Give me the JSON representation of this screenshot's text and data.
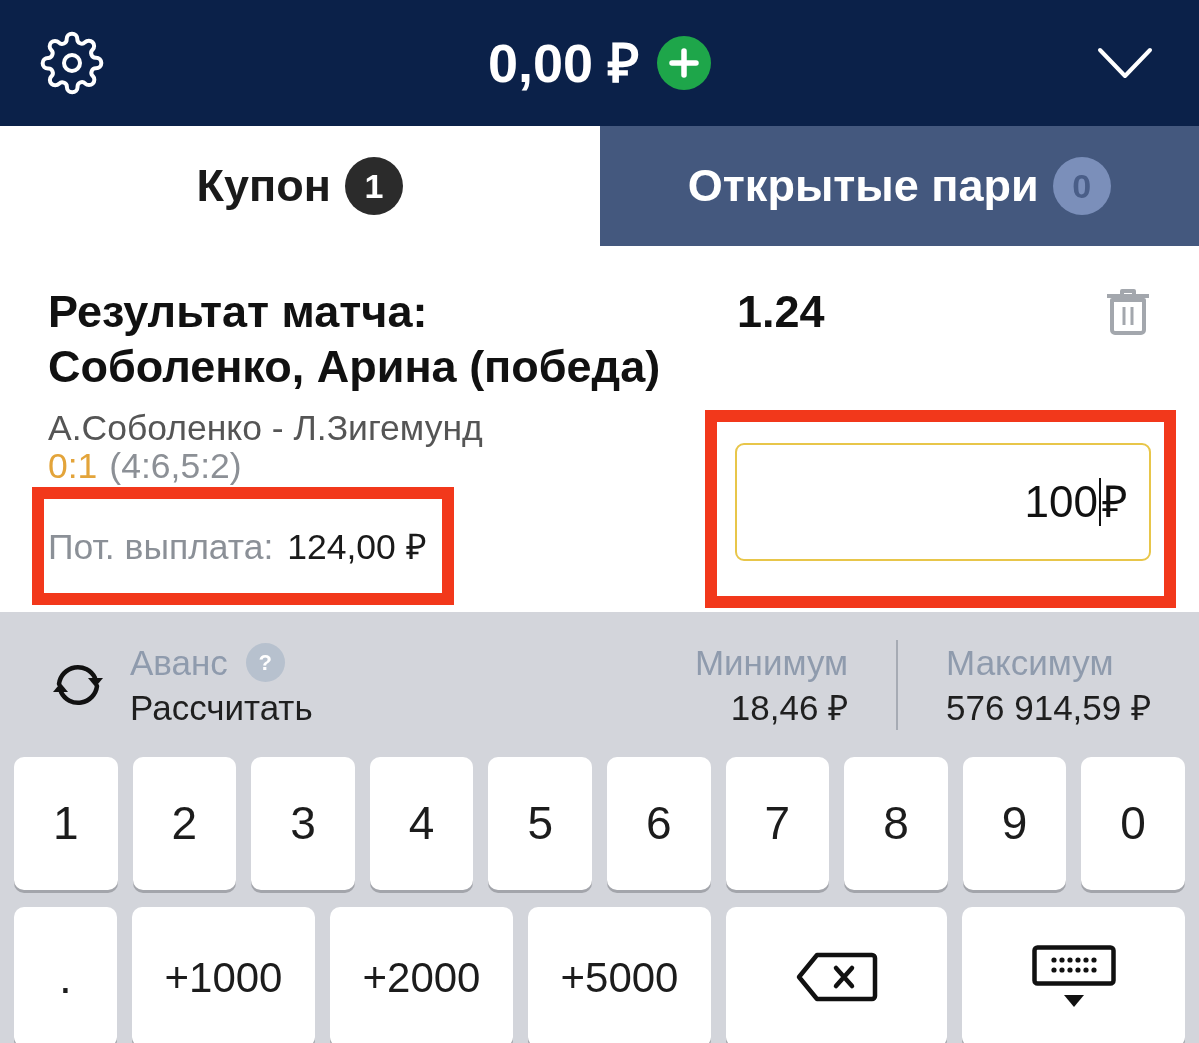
{
  "top_bar": {
    "balance": "0,00 ₽"
  },
  "tabs": [
    {
      "label": "Купон",
      "count": "1",
      "selected": true
    },
    {
      "label": "Открытые пари",
      "count": "0",
      "selected": false
    }
  ],
  "bet": {
    "title": "Результат матча: Соболенко, Арина (победа)",
    "odds": "1.24",
    "event": "А.Соболенко - Л.Зигемунд",
    "score": "0:1",
    "set_scores": "(4:6,5:2)",
    "payout_label": "Пот. выплата:",
    "payout": "124,00 ₽",
    "payout_highlighted": true,
    "stake": {
      "value": "100",
      "currency": "₽",
      "focused": true,
      "highlighted": true
    }
  },
  "advance": {
    "label": "Аванс",
    "help": "?",
    "action": "Рассчитать"
  },
  "limits": [
    {
      "label": "Минимум",
      "value": "18,46 ₽"
    },
    {
      "label": "Максимум",
      "value": "576 914,59 ₽"
    }
  ],
  "keypad": {
    "number_keys": [
      {
        "kind": "digit",
        "label": "1"
      },
      {
        "kind": "digit",
        "label": "2"
      },
      {
        "kind": "digit",
        "label": "3"
      },
      {
        "kind": "digit",
        "label": "4"
      },
      {
        "kind": "digit",
        "label": "5"
      },
      {
        "kind": "digit",
        "label": "6"
      },
      {
        "kind": "digit",
        "label": "7"
      },
      {
        "kind": "digit",
        "label": "8"
      },
      {
        "kind": "digit",
        "label": "9"
      },
      {
        "kind": "digit",
        "label": "0"
      }
    ],
    "action_keys": [
      {
        "kind": "dot",
        "label": "."
      },
      {
        "kind": "amount",
        "label": "+1000"
      },
      {
        "kind": "amount",
        "label": "+2000"
      },
      {
        "kind": "amount",
        "label": "+5000"
      },
      {
        "kind": "backspace"
      },
      {
        "kind": "hide"
      }
    ]
  }
}
